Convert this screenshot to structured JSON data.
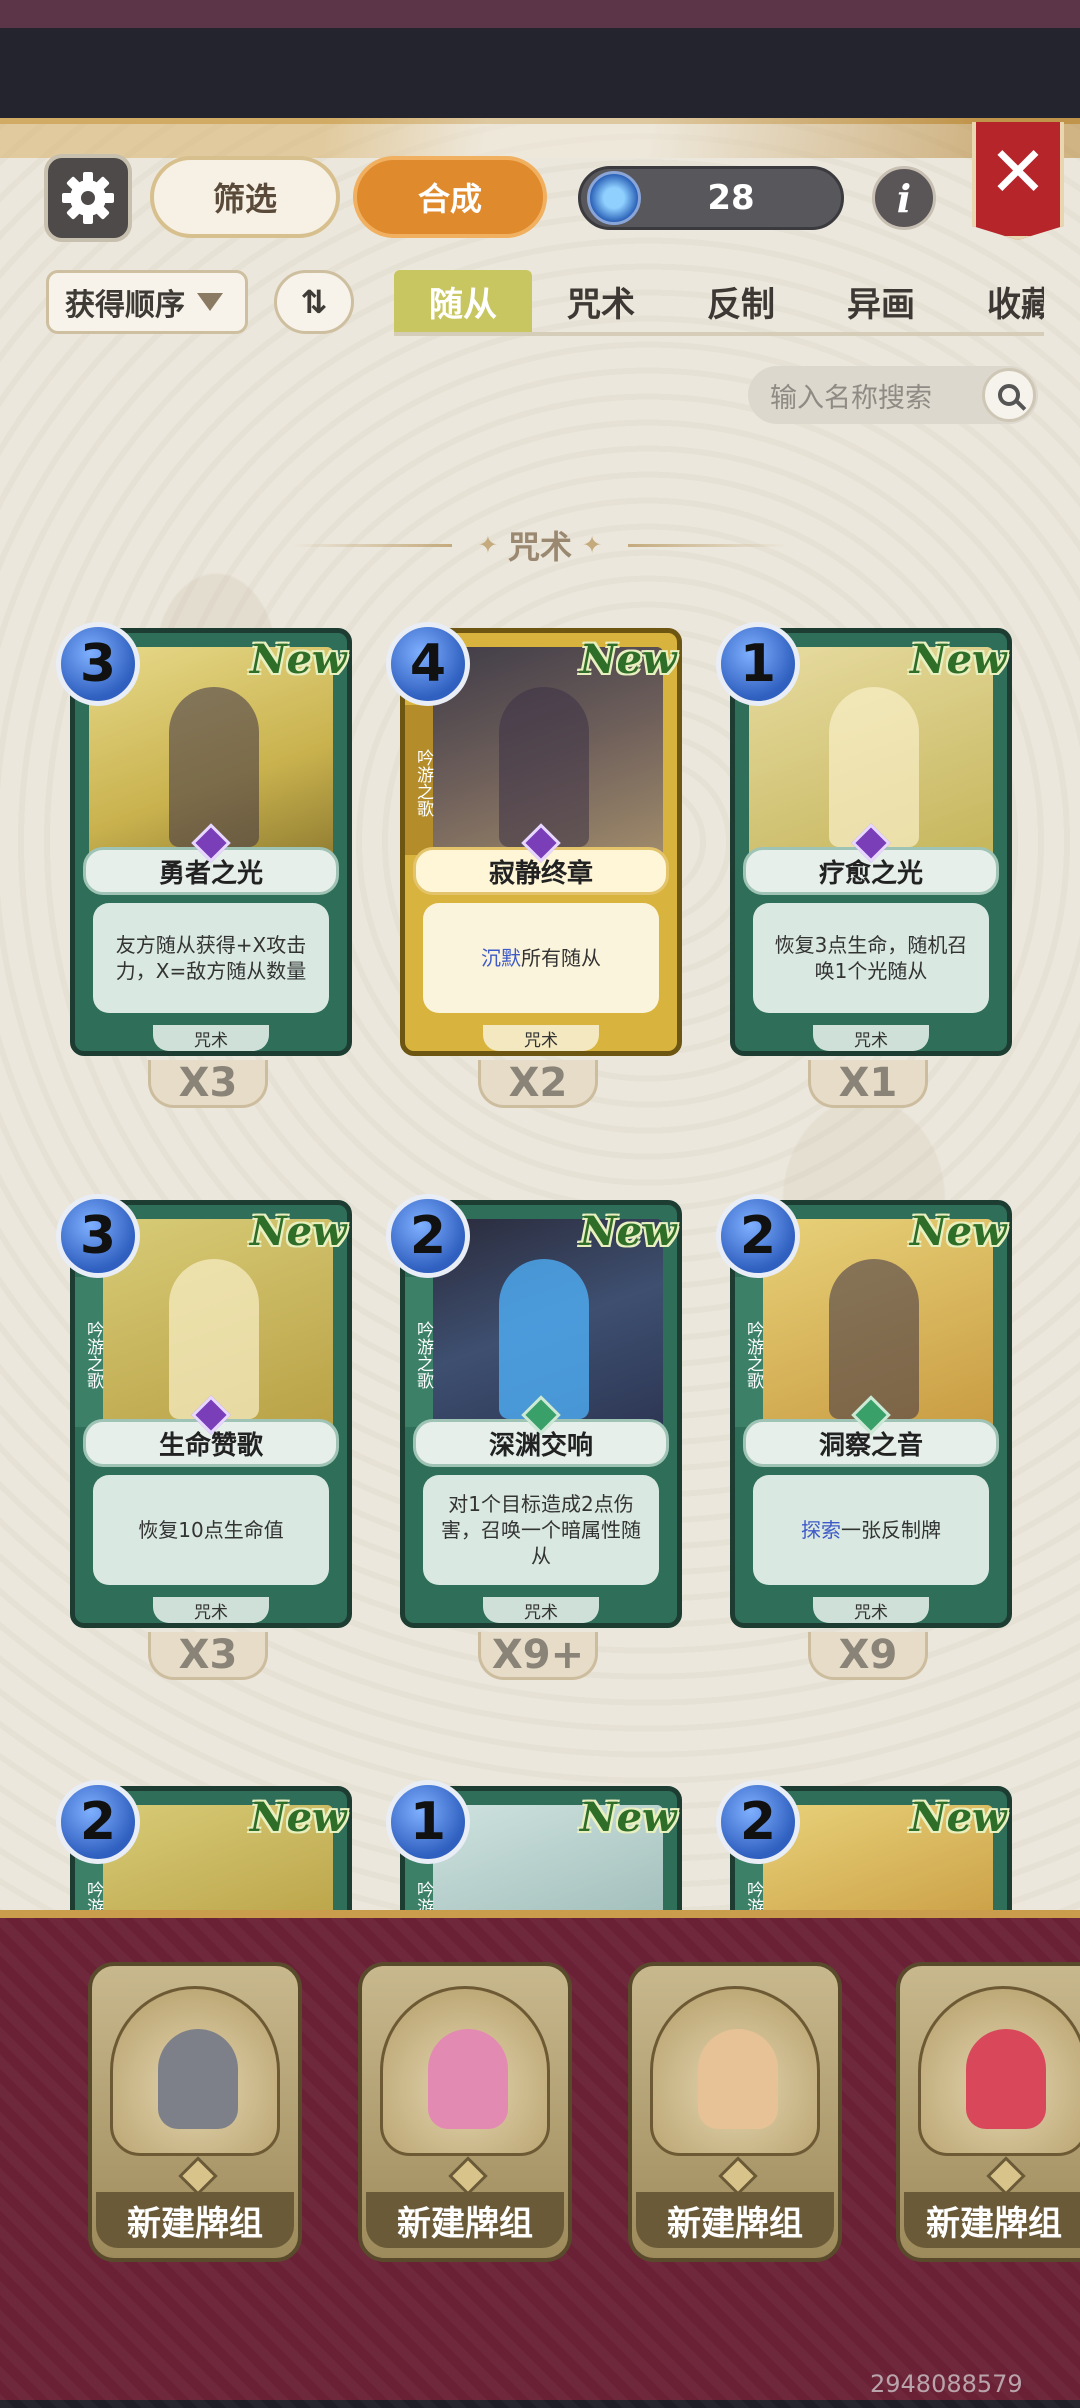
{
  "header": {
    "filter_label": "筛选",
    "craft_label": "合成",
    "currency_value": "28",
    "info_label": "i",
    "close_label": "✕"
  },
  "toolbar": {
    "sort_label": "获得顺序",
    "sort_toggle": "⇅",
    "tabs": [
      {
        "label": "随从",
        "active": true
      },
      {
        "label": "咒术",
        "active": false
      },
      {
        "label": "反制",
        "active": false
      },
      {
        "label": "异画",
        "active": false
      },
      {
        "label": "收藏",
        "active": false
      }
    ],
    "search_placeholder": "输入名称搜索"
  },
  "section": {
    "title": "咒术"
  },
  "cards": [
    {
      "name": "勇者之光",
      "cost": "3",
      "new": "New",
      "desc": "友方随从获得+X攻击力，X=敌方随从数量",
      "type": "咒术",
      "count": "X3",
      "side": ""
    },
    {
      "name": "寂静终章",
      "cost": "4",
      "new": "New",
      "desc_kw": "沉默",
      "desc": "所有随从",
      "type": "咒术",
      "count": "X2",
      "side": "吟游之歌"
    },
    {
      "name": "疗愈之光",
      "cost": "1",
      "new": "New",
      "desc": "恢复3点生命，随机召唤1个光随从",
      "type": "咒术",
      "count": "X1",
      "side": ""
    },
    {
      "name": "生命赞歌",
      "cost": "3",
      "new": "New",
      "desc": "恢复10点生命值",
      "type": "咒术",
      "count": "X3",
      "side": "吟游之歌"
    },
    {
      "name": "深渊交响",
      "cost": "2",
      "new": "New",
      "desc": "对1个目标造成2点伤害，召唤一个暗属性随从",
      "type": "咒术",
      "count": "X9+",
      "side": "吟游之歌"
    },
    {
      "name": "洞察之音",
      "cost": "2",
      "new": "New",
      "desc_kw": "探索",
      "desc": "一张反制牌",
      "type": "咒术",
      "count": "X9",
      "side": "吟游之歌"
    },
    {
      "name": "",
      "cost": "2",
      "new": "New",
      "side": "吟游"
    },
    {
      "name": "",
      "cost": "1",
      "new": "New",
      "side": "吟游"
    },
    {
      "name": "",
      "cost": "2",
      "new": "New",
      "side": "吟游"
    }
  ],
  "decks": [
    {
      "label": "新建牌组",
      "portrait": "armored-knight"
    },
    {
      "label": "新建牌组",
      "portrait": "horned-elf"
    },
    {
      "label": "新建牌组",
      "portrait": "young-hero"
    },
    {
      "label": "新建牌组",
      "portrait": "red-haired-witch"
    }
  ],
  "watermark": "2948088579"
}
